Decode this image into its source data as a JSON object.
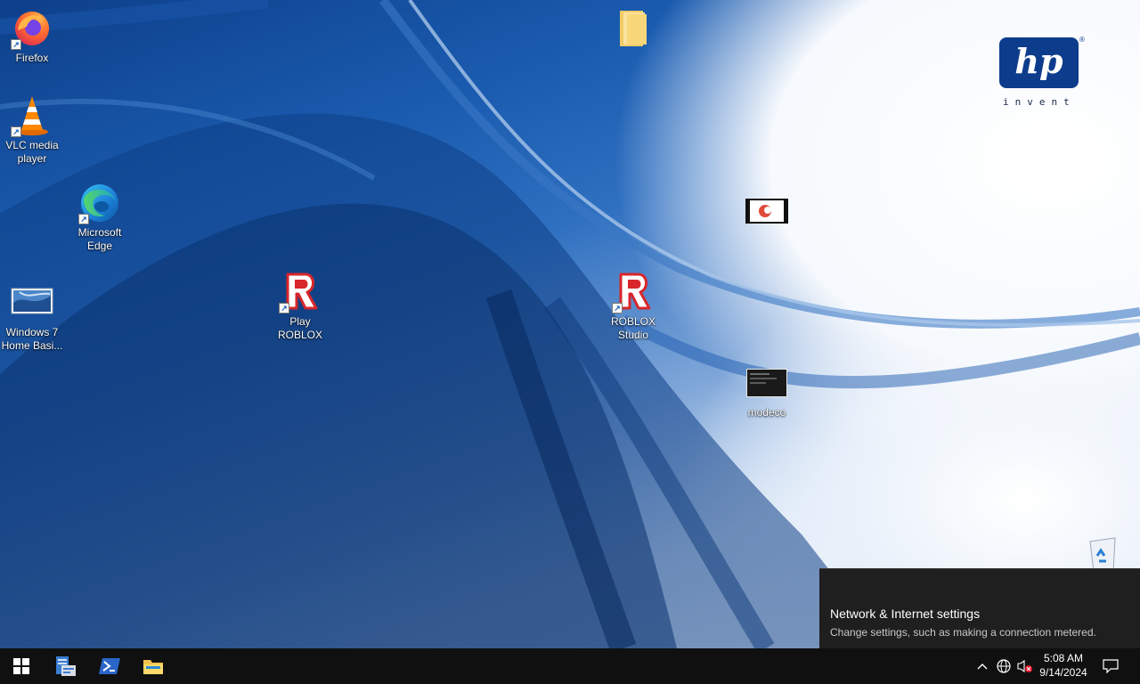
{
  "desktop_icons": {
    "firefox": "Firefox",
    "vlc_line1": "VLC media",
    "vlc_line2": "player",
    "edge_line1": "Microsoft",
    "edge_line2": "Edge",
    "win7_line1": "Windows 7",
    "win7_line2": "Home Basi...",
    "play_roblox": "Play ROBLOX",
    "studio_line1": "ROBLOX",
    "studio_line2": "Studio",
    "modeco": "modeco"
  },
  "wallpaper_logo": {
    "brand": "hp",
    "tagline": "invent",
    "reg_mark": "®"
  },
  "notification": {
    "title": "Network & Internet settings",
    "subtitle": "Change settings, such as making a connection metered."
  },
  "taskbar": {
    "time": "5:08 AM",
    "date": "9/14/2024",
    "pinned": [
      "start-icon",
      "server-manager-icon",
      "powershell-icon",
      "file-explorer-icon"
    ],
    "tray": [
      "chevron-up-icon",
      "globe-network-icon",
      "speaker-muted-icon",
      "action-center-icon"
    ]
  },
  "colors": {
    "taskbar_bg": "#101010",
    "toast_bg": "#1f1f1f",
    "hp_blue": "#0d3c8c"
  }
}
